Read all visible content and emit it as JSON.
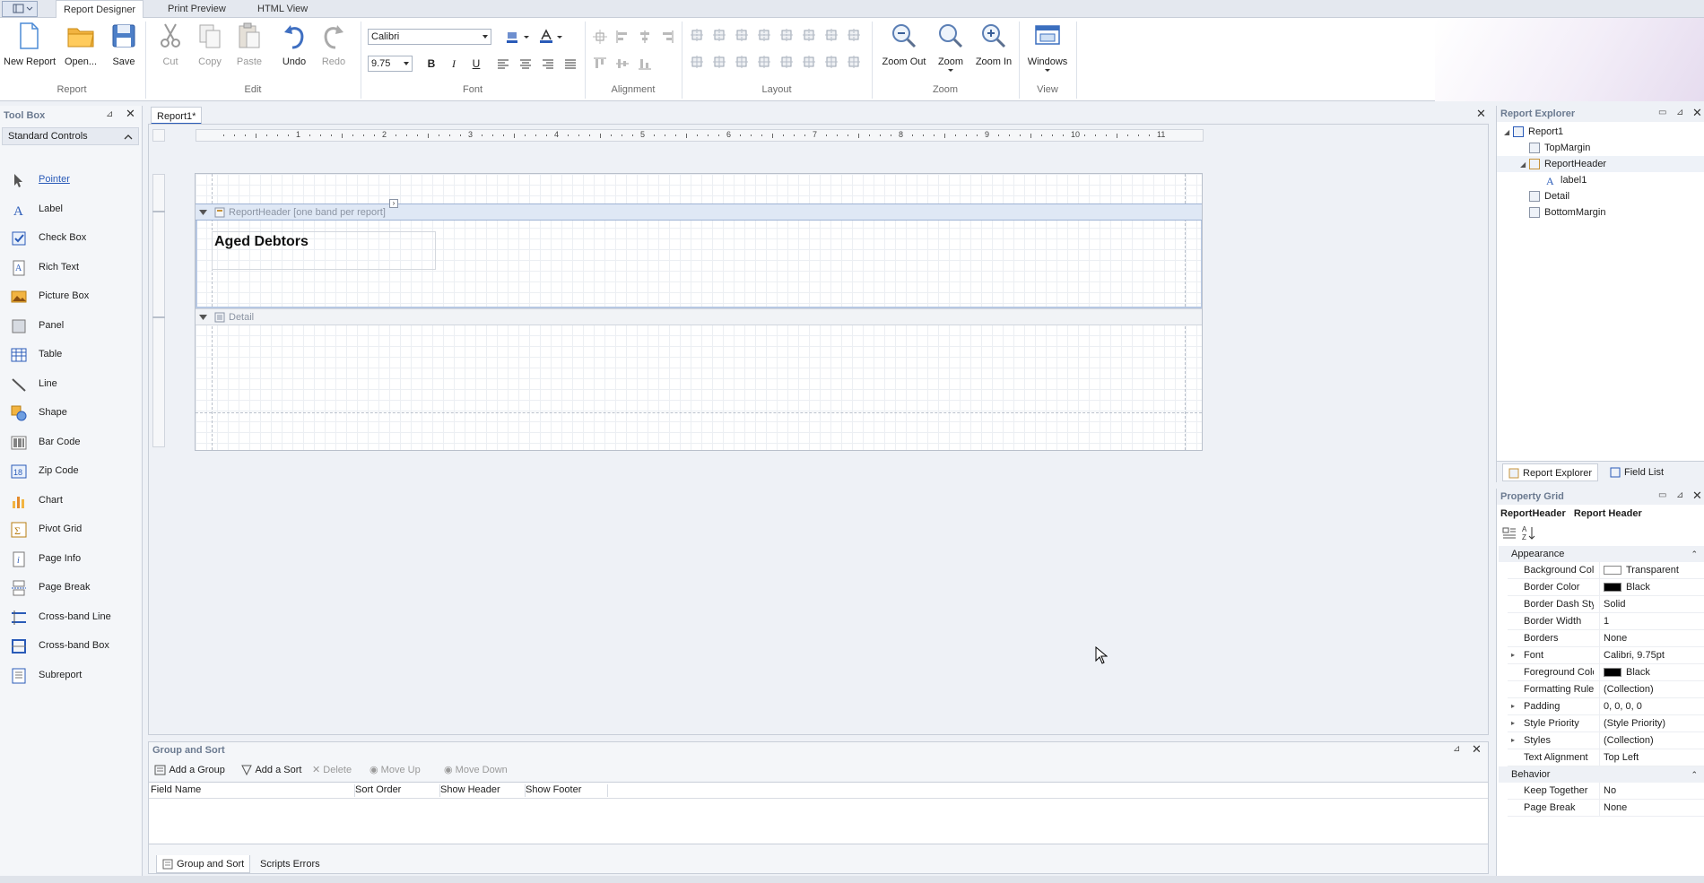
{
  "tabs": {
    "report_designer": "Report Designer",
    "print_preview": "Print Preview",
    "html_view": "HTML View"
  },
  "ribbon": {
    "report": {
      "title": "Report",
      "new_report": "New Report",
      "open": "Open...",
      "save": "Save"
    },
    "edit": {
      "title": "Edit",
      "cut": "Cut",
      "copy": "Copy",
      "paste": "Paste",
      "undo": "Undo",
      "redo": "Redo"
    },
    "font": {
      "title": "Font",
      "family": "Calibri",
      "size": "9.75"
    },
    "alignment": {
      "title": "Alignment"
    },
    "layout": {
      "title": "Layout"
    },
    "zoom": {
      "title": "Zoom",
      "zoom_out": "Zoom Out",
      "zoom": "Zoom",
      "zoom_in": "Zoom In"
    },
    "view": {
      "title": "View",
      "windows": "Windows"
    }
  },
  "toolbox": {
    "title": "Tool Box",
    "category": "Standard Controls",
    "items": [
      "Pointer",
      "Label",
      "Check Box",
      "Rich Text",
      "Picture Box",
      "Panel",
      "Table",
      "Line",
      "Shape",
      "Bar Code",
      "Zip Code",
      "Chart",
      "Pivot Grid",
      "Page Info",
      "Page Break",
      "Cross-band Line",
      "Cross-band Box",
      "Subreport"
    ]
  },
  "document": {
    "tab": "Report1*",
    "report_header_band": "ReportHeader [one band per report]",
    "detail_band": "Detail",
    "label_text": "Aged Debtors",
    "ruler_numbers": [
      "1",
      "2",
      "3",
      "4",
      "5",
      "6",
      "7",
      "8",
      "9",
      "10",
      "11"
    ]
  },
  "group_sort": {
    "title": "Group and Sort",
    "add_group": "Add a Group",
    "add_sort": "Add a Sort",
    "delete": "Delete",
    "move_up": "Move Up",
    "move_down": "Move Down",
    "columns": [
      "Field Name",
      "Sort Order",
      "Show Header",
      "Show Footer"
    ],
    "bottom_tabs": [
      "Group and Sort",
      "Scripts Errors"
    ]
  },
  "report_explorer": {
    "title": "Report Explorer",
    "tree": [
      "Report1",
      "TopMargin",
      "ReportHeader",
      "label1",
      "Detail",
      "BottomMargin"
    ],
    "tabs": [
      "Report Explorer",
      "Field List"
    ]
  },
  "property_grid": {
    "title": "Property Grid",
    "object_name": "ReportHeader",
    "object_type": "Report Header",
    "categories": [
      "Appearance",
      "Behavior"
    ],
    "appearance": [
      {
        "k": "Background Color",
        "v": "Transparent"
      },
      {
        "k": "Border Color",
        "v": "Black"
      },
      {
        "k": "Border Dash Style",
        "v": "Solid"
      },
      {
        "k": "Border Width",
        "v": "1"
      },
      {
        "k": "Borders",
        "v": "None"
      },
      {
        "k": "Font",
        "v": "Calibri, 9.75pt"
      },
      {
        "k": "Foreground Color",
        "v": "Black"
      },
      {
        "k": "Formatting Rules",
        "v": "(Collection)"
      },
      {
        "k": "Padding",
        "v": "0, 0, 0, 0"
      },
      {
        "k": "Style Priority",
        "v": "(Style Priority)"
      },
      {
        "k": "Styles",
        "v": "(Collection)"
      },
      {
        "k": "Text Alignment",
        "v": "Top Left"
      }
    ],
    "behavior": [
      {
        "k": "Keep Together",
        "v": "No"
      },
      {
        "k": "Page Break",
        "v": "None"
      }
    ]
  },
  "colors": {
    "accent": "#2a5bb8",
    "band_selected": "#dfe8f5"
  }
}
